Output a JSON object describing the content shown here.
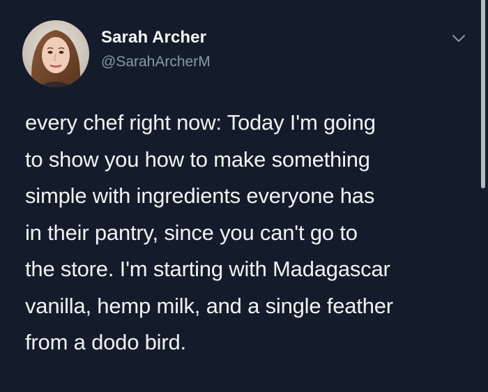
{
  "tweet": {
    "author": {
      "display_name": "Sarah Archer",
      "handle": "@SarahArcherM"
    },
    "menu_icon": "chevron-down-icon",
    "text_lines": [
      "every chef right now: Today I'm going",
      "to show you how to make something",
      "simple with ingredients everyone has",
      "in their pantry, since you can't go to",
      "the store. I'm starting with Madagascar",
      "vanilla, hemp milk, and a single feather",
      "from a dodo bird."
    ]
  },
  "colors": {
    "background": "#141c2b",
    "text": "#f0f3f5",
    "secondary_text": "#8899a6"
  }
}
